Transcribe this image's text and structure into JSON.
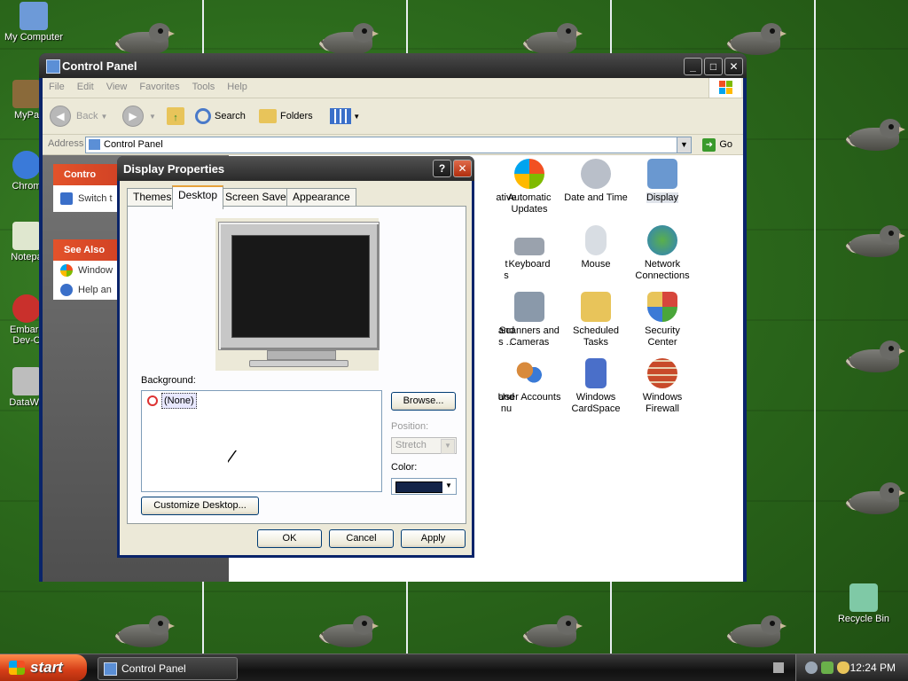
{
  "desktop": {
    "icons": [
      {
        "label": "My Computer",
        "color": "#6d9ad8"
      },
      {
        "label": "MyPa",
        "color": "#8a6a3a"
      },
      {
        "label": "Chrom",
        "color": "#3a7ad9"
      },
      {
        "label": "Notepa",
        "color": "#dfe7cf"
      },
      {
        "label": "Embarc",
        "label2": "Dev-C",
        "color": "#c9302c"
      },
      {
        "label": "DataWa",
        "color": "#bdbdbd"
      },
      {
        "label": "Recycle Bin",
        "color": "#7fc9a6"
      }
    ]
  },
  "control_panel": {
    "title": "Control Panel",
    "menu": [
      "File",
      "Edit",
      "View",
      "Favorites",
      "Tools",
      "Help"
    ],
    "toolbar": {
      "back": "Back",
      "search": "Search",
      "folders": "Folders"
    },
    "address_label": "Address",
    "address_value": "Control Panel",
    "go": "Go",
    "left_panel": {
      "cp_header": "Contro",
      "cp_row": "Switch t",
      "see_also_header": "See Also",
      "see_also_rows": [
        "Window",
        "Help an"
      ]
    },
    "items": [
      {
        "label": "ative",
        "color": "#ffffff"
      },
      {
        "label": "Automatic\nUpdates",
        "color": "#3c7ad6"
      },
      {
        "label": "Date and Time",
        "color": "#b9bfc9"
      },
      {
        "label": "Display",
        "color": "#6a98d0"
      },
      {
        "label": "t\ns",
        "color": "#ffffff"
      },
      {
        "label": "Keyboard",
        "color": "#9aa2ad"
      },
      {
        "label": "Mouse",
        "color": "#d8dde3"
      },
      {
        "label": "Network\nConnections",
        "color": "#2f7fc4"
      },
      {
        "label": "and\ns ...",
        "color": "#ffffff"
      },
      {
        "label": "Scanners and\nCameras",
        "color": "#8a99aa"
      },
      {
        "label": "Scheduled\nTasks",
        "color": "#e8c45a"
      },
      {
        "label": "Security\nCenter",
        "color": "#d7463c"
      },
      {
        "label": "and\nnu",
        "color": "#ffffff"
      },
      {
        "label": "User Accounts",
        "color": "#d88a3c"
      },
      {
        "label": "Windows\nCardSpace",
        "color": "#4a6fc9"
      },
      {
        "label": "Windows\nFirewall",
        "color": "#c84a2a"
      }
    ]
  },
  "dialog": {
    "title": "Display Properties",
    "tabs": [
      "Themes",
      "Desktop",
      "Screen Saver",
      "Appearance"
    ],
    "active_tab": "Desktop",
    "background_label": "Background:",
    "background_items": [
      "(None)"
    ],
    "browse": "Browse...",
    "position_label": "Position:",
    "position_value": "Stretch",
    "color_label": "Color:",
    "color_value": "#132348",
    "customize": "Customize Desktop...",
    "ok": "OK",
    "cancel": "Cancel",
    "apply": "Apply"
  },
  "taskbar": {
    "start": "start",
    "task": "Control Panel",
    "clock": "12:24 PM"
  }
}
